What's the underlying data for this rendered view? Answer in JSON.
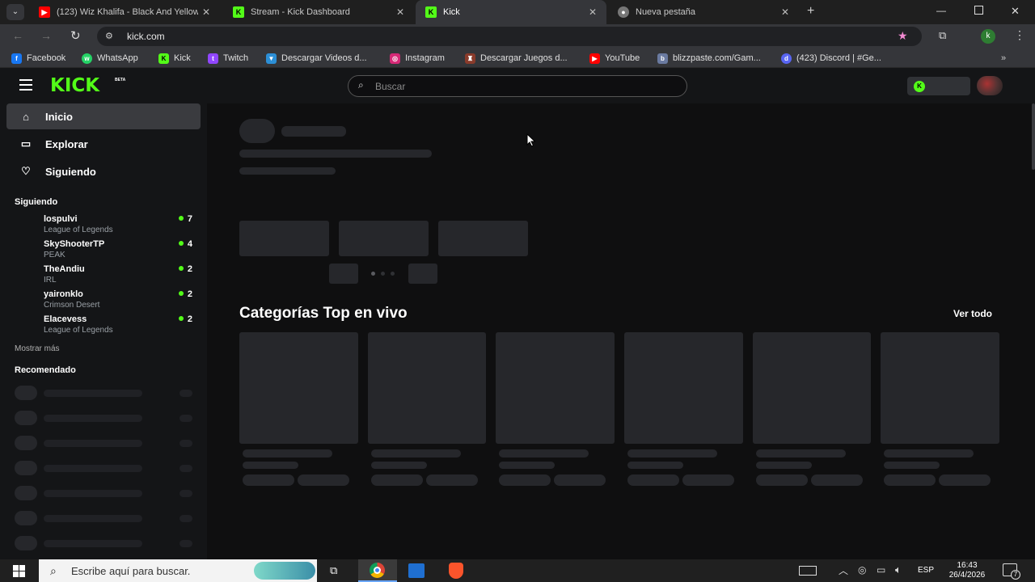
{
  "browser": {
    "tabs": [
      {
        "title": "(123) Wiz Khalifa - Black And Yellow",
        "icon": "youtube-icon",
        "active": false
      },
      {
        "title": "Stream - Kick Dashboard",
        "icon": "kick-icon",
        "active": false
      },
      {
        "title": "Kick",
        "icon": "kick-icon",
        "active": true
      },
      {
        "title": "Nueva pestaña",
        "icon": "chrome-icon",
        "active": false
      }
    ],
    "url": "kick.com",
    "profile_initial": "k",
    "bookmarks": [
      {
        "label": "Facebook",
        "icon": "facebook-icon",
        "color": "#1877f2",
        "glyph": "f"
      },
      {
        "label": "WhatsApp",
        "icon": "whatsapp-icon",
        "color": "#25d366",
        "glyph": "w"
      },
      {
        "label": "Kick",
        "icon": "kick-icon",
        "color": "#53fc18",
        "glyph": "K"
      },
      {
        "label": "Twitch",
        "icon": "twitch-icon",
        "color": "#9146ff",
        "glyph": "t"
      },
      {
        "label": "Descargar Videos d...",
        "icon": "download-icon",
        "color": "#2c8fd6",
        "glyph": "▼"
      },
      {
        "label": "Instagram",
        "icon": "instagram-icon",
        "color": "#d62976",
        "glyph": "◎"
      },
      {
        "label": "Descargar Juegos d...",
        "icon": "joystick-icon",
        "color": "#8a3b2b",
        "glyph": "♜"
      },
      {
        "label": "YouTube",
        "icon": "youtube-icon",
        "color": "#ff0000",
        "glyph": "▶"
      },
      {
        "label": "blizzpaste.com/Gam...",
        "icon": "blizzpaste-icon",
        "color": "#6a7aa0",
        "glyph": "b"
      },
      {
        "label": "(423) Discord | #Ge...",
        "icon": "discord-icon",
        "color": "#5865f2",
        "glyph": "d"
      }
    ]
  },
  "kick": {
    "logo": "KICK",
    "logo_badge": "BETA",
    "search_placeholder": "Buscar",
    "nav": [
      {
        "label": "Inicio",
        "icon": "home-icon"
      },
      {
        "label": "Explorar",
        "icon": "explore-icon"
      },
      {
        "label": "Siguiendo",
        "icon": "heart-icon"
      }
    ],
    "following_heading": "Siguiendo",
    "following": [
      {
        "name": "lospulvi",
        "game": "League of Legends",
        "viewers": "7"
      },
      {
        "name": "SkyShooterTP",
        "game": "PEAK",
        "viewers": "4"
      },
      {
        "name": "TheAndiu",
        "game": "IRL",
        "viewers": "2"
      },
      {
        "name": "yaironklo",
        "game": "Crimson Desert",
        "viewers": "2"
      },
      {
        "name": "Elacevess",
        "game": "League of Legends",
        "viewers": "2"
      }
    ],
    "show_more": "Mostrar más",
    "recommended_heading": "Recomendado",
    "categories_heading": "Categorías Top en vivo",
    "see_all": "Ver todo"
  },
  "taskbar": {
    "search_placeholder": "Escribe aquí para buscar.",
    "language": "ESP",
    "time": "16:43",
    "date": "26/4/2026",
    "notifications": "7"
  },
  "colors": {
    "kick_green": "#53fc18",
    "page_bg": "#0f0f10",
    "sidebar_bg": "#141517",
    "skeleton": "#26272b"
  }
}
